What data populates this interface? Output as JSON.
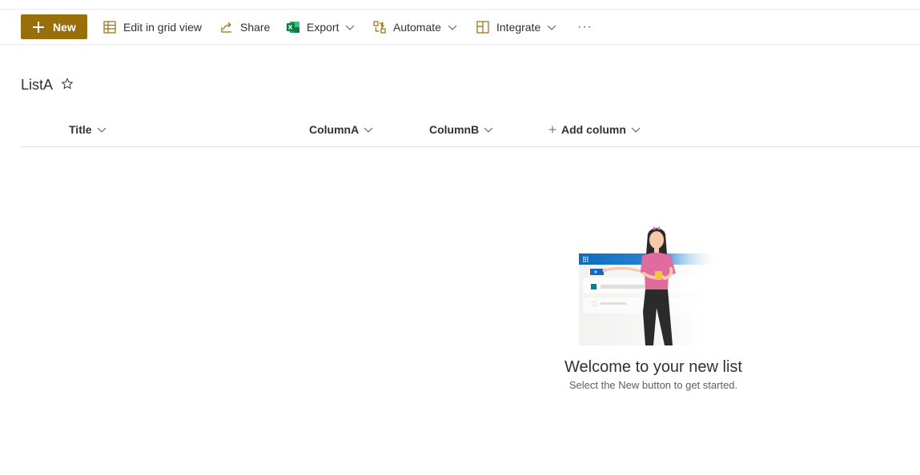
{
  "toolbar": {
    "new_label": "New",
    "edit_grid_label": "Edit in grid view",
    "share_label": "Share",
    "export_label": "Export",
    "automate_label": "Automate",
    "integrate_label": "Integrate",
    "more_label": "···"
  },
  "list": {
    "title": "ListA"
  },
  "columns": [
    {
      "label": "Title"
    },
    {
      "label": "ColumnA"
    },
    {
      "label": "ColumnB"
    },
    {
      "label": "Add column"
    }
  ],
  "empty_state": {
    "heading": "Welcome to your new list",
    "subtext": "Select the New button to get started."
  },
  "colors": {
    "accent": "#986f0b",
    "excel_green": "#107c41",
    "illustration_blue": "#0f6cbd",
    "illustration_pink": "#e06c9f"
  },
  "icons": [
    "plus-icon",
    "grid-icon",
    "share-icon",
    "excel-icon",
    "automate-icon",
    "integrate-icon",
    "chevron-down-icon",
    "star-icon",
    "more-icon"
  ]
}
